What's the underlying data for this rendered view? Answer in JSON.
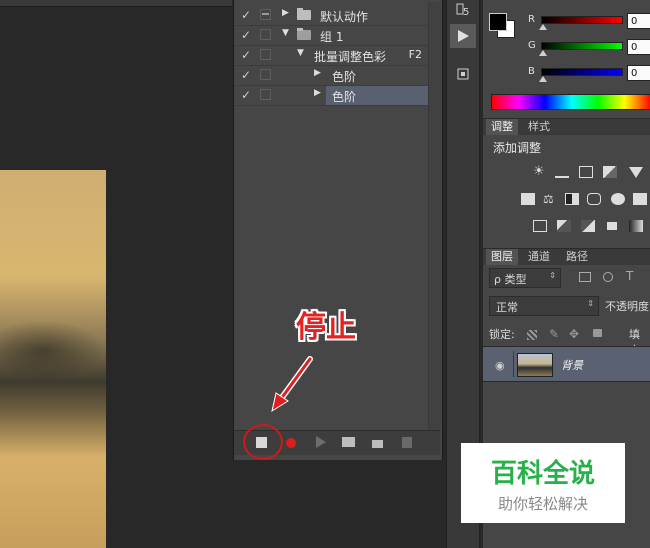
{
  "actions_panel": {
    "rows": [
      {
        "check": "✓",
        "expand": "▶",
        "folder": true,
        "label": "默认动作",
        "key": ""
      },
      {
        "check": "✓",
        "expand": "▼",
        "folder": true,
        "label": "组 1",
        "key": ""
      },
      {
        "check": "✓",
        "expand": "▼",
        "folder": false,
        "label": "批量调整色彩",
        "key": "F2"
      },
      {
        "check": "✓",
        "expand": "▶",
        "folder": false,
        "label": "色阶",
        "key": ""
      },
      {
        "check": "✓",
        "expand": "▶",
        "folder": false,
        "label": "色阶",
        "key": ""
      }
    ]
  },
  "annotation": {
    "stop_label": "停止"
  },
  "color_panel": {
    "channels": [
      {
        "label": "R",
        "value": "0",
        "gradient": [
          "#000000",
          "#ff0000"
        ]
      },
      {
        "label": "G",
        "value": "0",
        "gradient": [
          "#000000",
          "#00ff00"
        ]
      },
      {
        "label": "B",
        "value": "0",
        "gradient": [
          "#000000",
          "#0000ff"
        ]
      }
    ],
    "foreground": "#000000",
    "background": "#ffffff"
  },
  "adjustments_panel": {
    "tabs": [
      "调整",
      "样式"
    ],
    "title": "添加调整"
  },
  "layers_panel": {
    "tabs": [
      "图层",
      "通道",
      "路径"
    ],
    "filter_label": "ρ 类型",
    "blend_mode": "正常",
    "opacity_label": "不透明度",
    "lock_label": "锁定:",
    "fill_label": "填充",
    "layer_name": "背景"
  },
  "watermark": {
    "title": "百科全说",
    "subtitle": "助你轻松解决"
  }
}
